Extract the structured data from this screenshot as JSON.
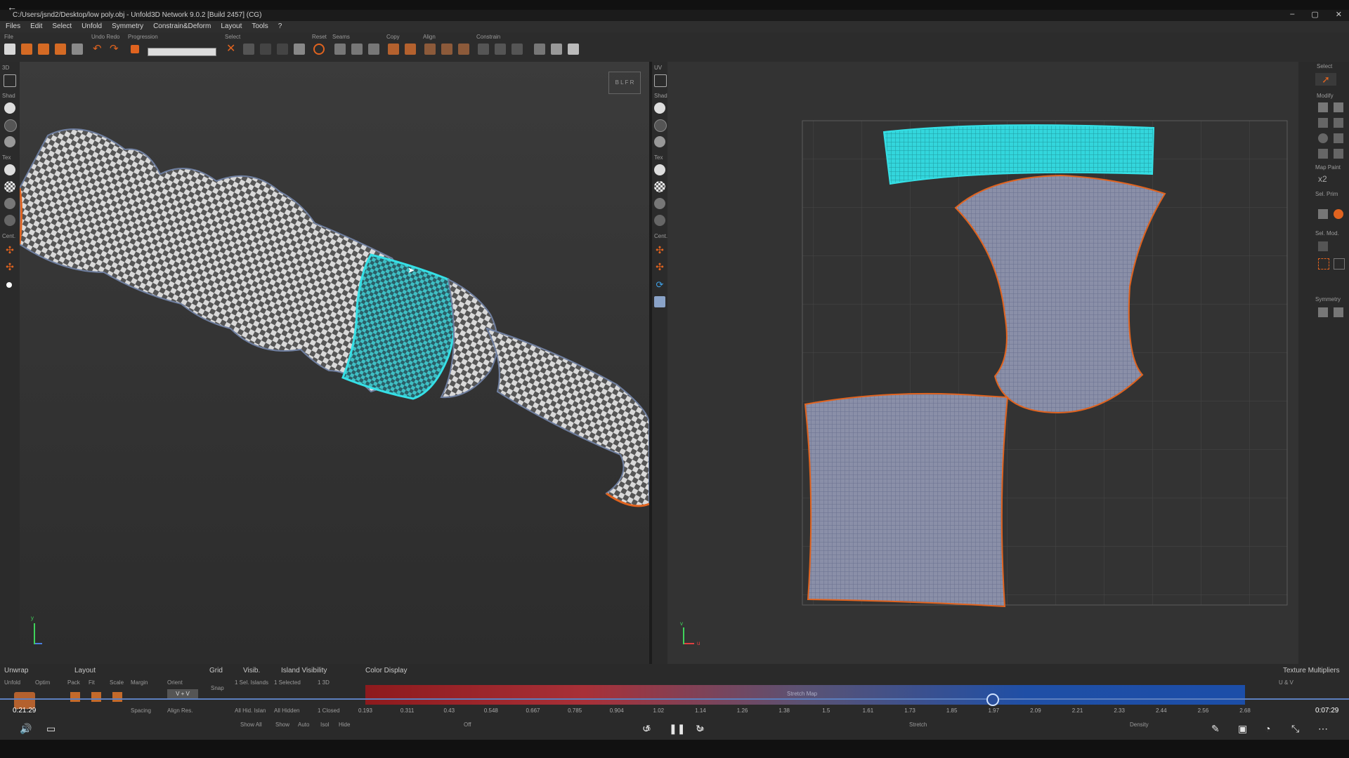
{
  "titlebar": {
    "title": "C:/Users/jsnd2/Desktop/low poly.obj - Unfold3D Network 9.0.2 [Build 2457] (CG)",
    "minimize": "–",
    "maximize": "▢",
    "close": "✕"
  },
  "menu": [
    "Files",
    "Edit",
    "Select",
    "Unfold",
    "Symmetry",
    "Constrain&Deform",
    "Layout",
    "Tools",
    "?"
  ],
  "toolbar": {
    "groups": [
      "File",
      "Undo Redo",
      "Progression",
      "Select",
      "Reset",
      "Seams",
      "Copy",
      "Align",
      "Constrain"
    ]
  },
  "left_sidebar": {
    "labels": [
      "3D",
      "Shad",
      "Tex",
      "Cent."
    ]
  },
  "uv_sidebar": {
    "labels": [
      "UV",
      "Shad",
      "Tex",
      "Cent."
    ]
  },
  "right_panel": {
    "labels": [
      "Select",
      "Modify",
      "Map Paint",
      "Sel. Prim",
      "Sel. Mod.",
      "Symmetry"
    ],
    "x2": "x2"
  },
  "viewcube": {
    "letters": "B L F R"
  },
  "axis3d": {
    "y": "y"
  },
  "axisuv": {
    "v": "v",
    "u": "u"
  },
  "bottom": {
    "sections": [
      "Unwrap",
      "Layout",
      "Grid",
      "Visib.",
      "Island Visibility",
      "Color Display",
      "Texture Multipliers"
    ],
    "unwrap_row": [
      "Unfold",
      "Optim",
      "Pack",
      "Fit",
      "Scale",
      "Margin",
      "Orient"
    ],
    "visib_row": [
      "1 Sel. Islands",
      "1 Selected",
      "1 3D"
    ],
    "visib_row2": [
      "All Hid. Islan",
      "All Hidden",
      "1 Closed"
    ],
    "grid_snap": "Snap",
    "spacing": "Spacing",
    "align_res": "Align Res.",
    "orient_value": "V + V",
    "uv_label": "U & V",
    "options": [
      "Show All",
      "Show",
      "Auto",
      "Isol",
      "Hide"
    ],
    "stretch_label": "Stretch Map",
    "ticks": [
      "0.193",
      "0.311",
      "0.43",
      "0.548",
      "0.667",
      "0.785",
      "0.904",
      "1.02",
      "1.14",
      "1.26",
      "1.38",
      "1.5",
      "1.61",
      "1.73",
      "1.85",
      "1.97",
      "2.09",
      "2.21",
      "2.33",
      "2.44",
      "2.56",
      "2.68"
    ],
    "mode_off": "Off",
    "mode_stretch": "Stretch",
    "mode_density": "Density"
  },
  "video": {
    "time_left": "0:21:29",
    "time_right": "0:07:29",
    "rewind": "10",
    "forward": "30"
  },
  "colors": {
    "accent": "#e0631f",
    "selection": "#2fe0e6",
    "bg": "#333333"
  }
}
